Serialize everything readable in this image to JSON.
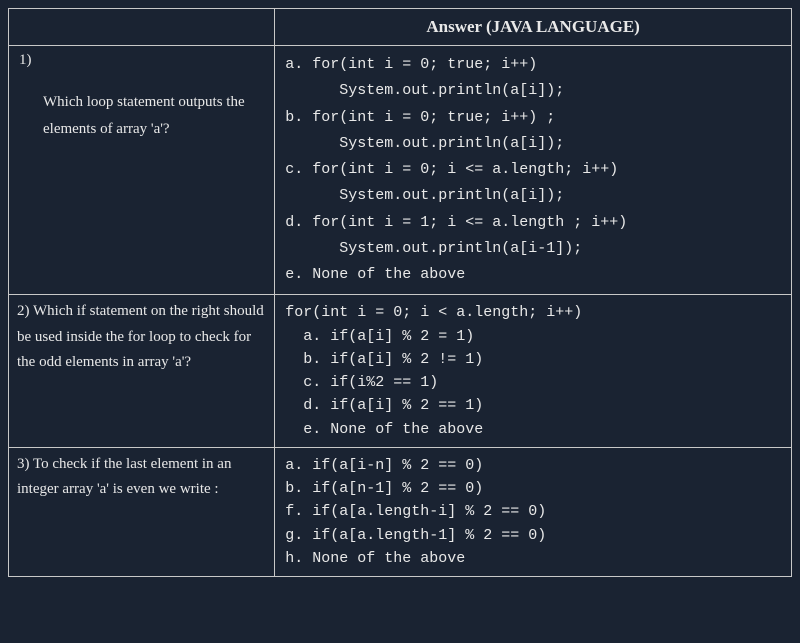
{
  "header": {
    "left": "",
    "right": "Answer (JAVA LANGUAGE)"
  },
  "rows": [
    {
      "num": "1)",
      "question": "Which loop statement outputs the elements of array 'a'?",
      "answer": "a. for(int i = 0; true; i++)\n      System.out.println(a[i]);\nb. for(int i = 0; true; i++) ;\n      System.out.println(a[i]);\nc. for(int i = 0; i <= a.length; i++)\n      System.out.println(a[i]);\nd. for(int i = 1; i <= a.length ; i++)\n      System.out.println(a[i-1]);\ne. None of the above"
    },
    {
      "num": "2)",
      "question": "Which if statement on the right should be used inside the for loop to check for the odd elements in array 'a'?",
      "answer": "for(int i = 0; i < a.length; i++)\n  a. if(a[i] % 2 = 1)\n  b. if(a[i] % 2 != 1)\n  c. if(i%2 == 1)\n  d. if(a[i] % 2 == 1)\n  e. None of the above"
    },
    {
      "num": "3)",
      "question": "To check if the last element in an integer array 'a' is even we write :",
      "answer": "a. if(a[i-n] % 2 == 0)\nb. if(a[n-1] % 2 == 0)\nf. if(a[a.length-i] % 2 == 0)\ng. if(a[a.length-1] % 2 == 0)\nh. None of the above"
    }
  ]
}
